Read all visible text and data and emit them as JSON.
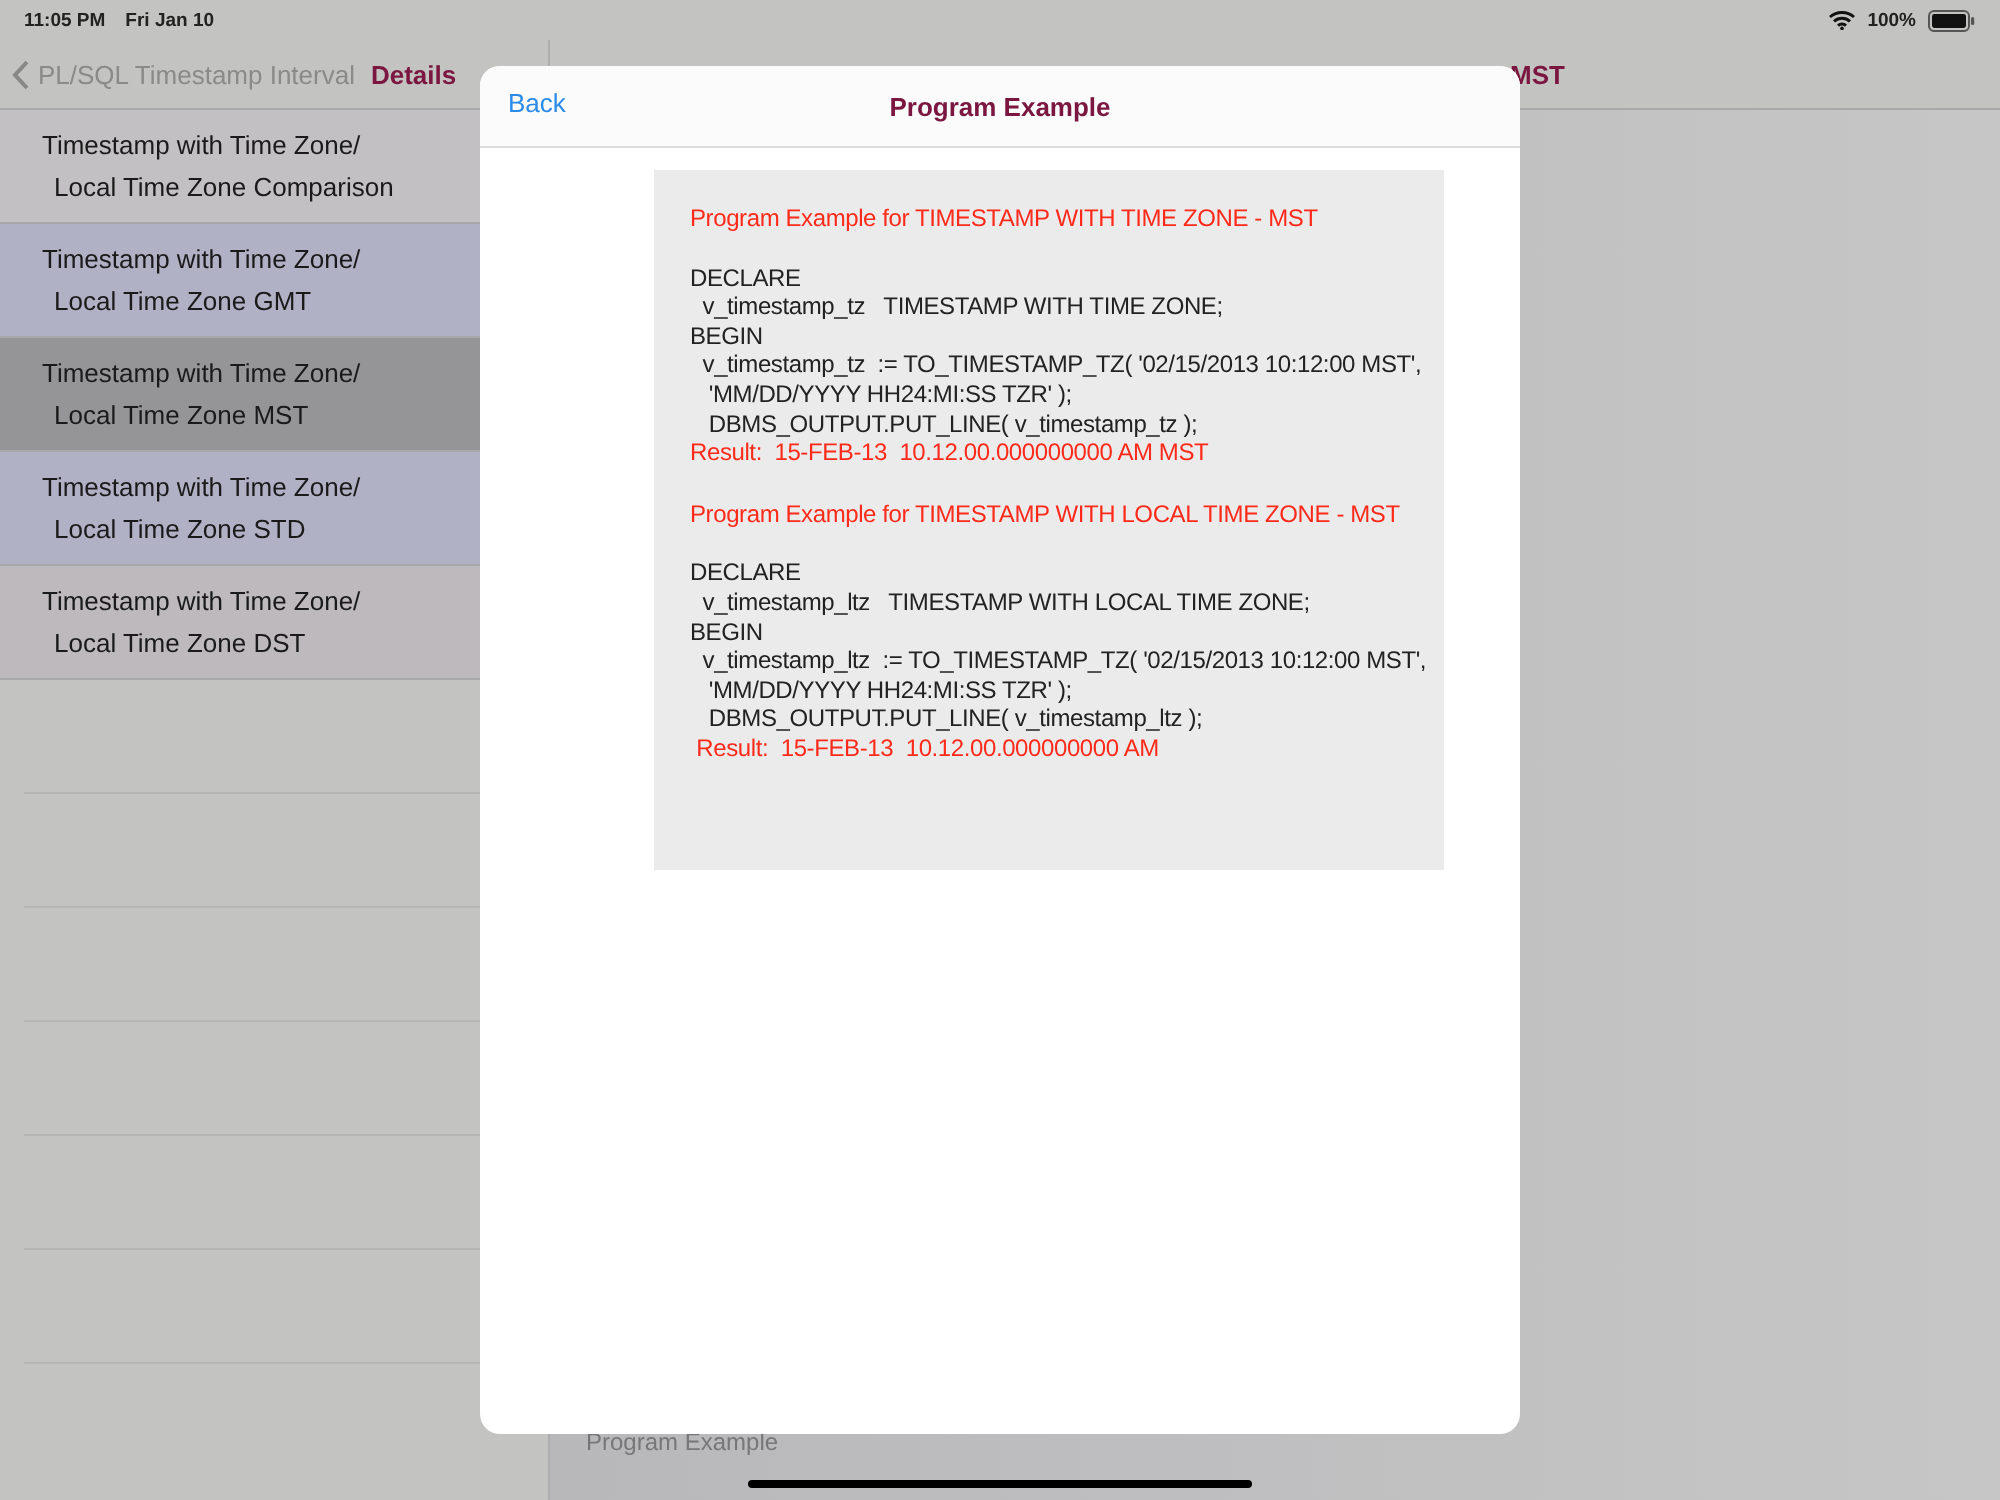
{
  "status_bar": {
    "time": "11:05 PM",
    "date": "Fri Jan 10",
    "battery": "100%"
  },
  "sidebar": {
    "back_label": "PL/SQL Timestamp Interval",
    "title": "Details",
    "items": [
      {
        "line1": "Timestamp with Time Zone/",
        "line2": "Local Time Zone Comparison",
        "color": "#c2c0c3"
      },
      {
        "line1": "Timestamp with Time Zone/",
        "line2": "Local Time Zone GMT",
        "color": "#b1b1c6"
      },
      {
        "line1": "Timestamp with Time Zone/",
        "line2": "Local Time Zone MST",
        "color": "#959497"
      },
      {
        "line1": "Timestamp with Time Zone/",
        "line2": "Local Time Zone STD",
        "color": "#b1b1c6"
      },
      {
        "line1": "Timestamp with Time Zone/",
        "line2": "Local Time Zone DST",
        "color": "#bdb9bc"
      }
    ]
  },
  "detail": {
    "title": "MST",
    "footer": "Program Example"
  },
  "modal": {
    "back": "Back",
    "title": "Program Example",
    "sections": [
      {
        "heading": "Program Example for TIMESTAMP WITH TIME ZONE - MST",
        "lines": [
          "DECLARE",
          "  v_timestamp_tz   TIMESTAMP WITH TIME ZONE;",
          "BEGIN",
          "  v_timestamp_tz  := TO_TIMESTAMP_TZ( '02/15/2013 10:12:00 MST',",
          "   'MM/DD/YYYY HH24:MI:SS TZR' );",
          "   DBMS_OUTPUT.PUT_LINE( v_timestamp_tz );"
        ],
        "result": "Result:  15-FEB-13  10.12.00.000000000 AM MST"
      },
      {
        "heading": "Program Example for TIMESTAMP WITH LOCAL TIME ZONE - MST",
        "lines": [
          "DECLARE",
          "  v_timestamp_ltz   TIMESTAMP WITH LOCAL TIME ZONE;",
          "BEGIN",
          "  v_timestamp_ltz  := TO_TIMESTAMP_TZ( '02/15/2013 10:12:00 MST',",
          "   'MM/DD/YYYY HH24:MI:SS TZR' );",
          "   DBMS_OUTPUT.PUT_LINE( v_timestamp_ltz );"
        ],
        "result": " Result:  15-FEB-13  10.12.00.000000000 AM"
      }
    ]
  }
}
